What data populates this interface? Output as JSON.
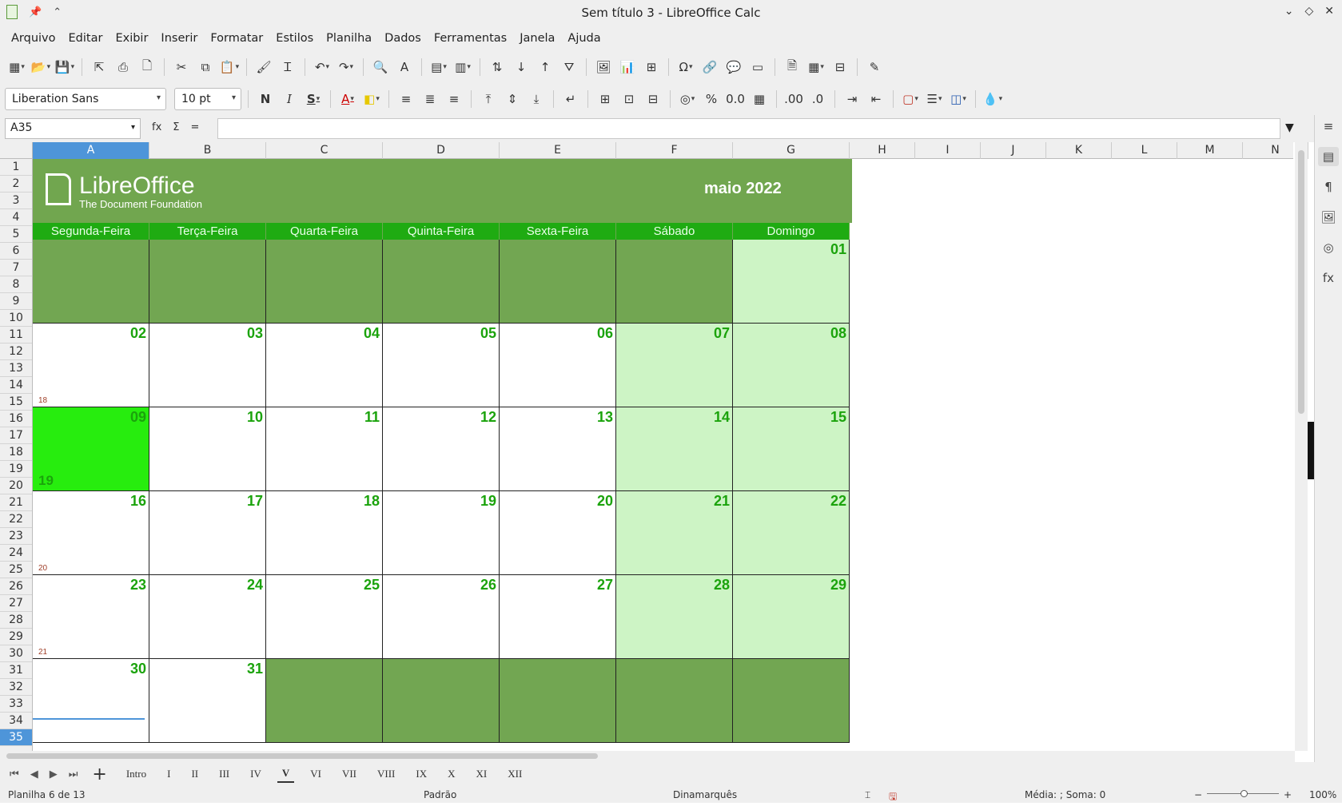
{
  "window": {
    "title": "Sem título 3 - LibreOffice Calc"
  },
  "menu": [
    "Arquivo",
    "Editar",
    "Exibir",
    "Inserir",
    "Formatar",
    "Estilos",
    "Planilha",
    "Dados",
    "Ferramentas",
    "Janela",
    "Ajuda"
  ],
  "format_bar": {
    "font_name": "Liberation Sans",
    "font_size": "10 pt",
    "bold": "N",
    "italic": "I",
    "underline": "S"
  },
  "formula_bar": {
    "cell_ref": "A35",
    "function_wizard": "fx",
    "sum": "Σ",
    "equals": "=",
    "content": ""
  },
  "columns": [
    "A",
    "B",
    "C",
    "D",
    "E",
    "F",
    "G",
    "H",
    "I",
    "J",
    "K",
    "L",
    "M",
    "N"
  ],
  "selected_column": "A",
  "rows": [
    "1",
    "2",
    "3",
    "4",
    "5",
    "6",
    "7",
    "8",
    "9",
    "10",
    "11",
    "12",
    "13",
    "14",
    "15",
    "16",
    "17",
    "18",
    "19",
    "20",
    "21",
    "22",
    "23",
    "24",
    "25",
    "26",
    "27",
    "28",
    "29",
    "30",
    "31",
    "32",
    "33",
    "34",
    "35"
  ],
  "selected_row": "35",
  "calendar": {
    "logo_brand": "LibreOffice",
    "logo_subtitle": "The Document Foundation",
    "month_title": "maio 2022",
    "weekdays": [
      "Segunda-Feira",
      "Terça-Feira",
      "Quarta-Feira",
      "Quinta-Feira",
      "Sexta-Feira",
      "Sábado",
      "Domingo"
    ],
    "weeks": [
      {
        "week_no": "",
        "days": [
          "",
          "",
          "",
          "",
          "",
          "",
          "01"
        ]
      },
      {
        "week_no": "18",
        "days": [
          "02",
          "03",
          "04",
          "05",
          "06",
          "07",
          "08"
        ]
      },
      {
        "week_no": "19",
        "days": [
          "09",
          "10",
          "11",
          "12",
          "13",
          "14",
          "15"
        ]
      },
      {
        "week_no": "20",
        "days": [
          "16",
          "17",
          "18",
          "19",
          "20",
          "21",
          "22"
        ]
      },
      {
        "week_no": "21",
        "days": [
          "23",
          "24",
          "25",
          "26",
          "27",
          "28",
          "29"
        ]
      },
      {
        "week_no": "",
        "days": [
          "30",
          "31",
          "",
          "",
          "",
          "",
          ""
        ]
      }
    ],
    "today": "09"
  },
  "sheet_tabs": [
    "Intro",
    "I",
    "II",
    "III",
    "IV",
    "V",
    "VI",
    "VII",
    "VIII",
    "IX",
    "X",
    "XI",
    "XII"
  ],
  "active_tab": "V",
  "status": {
    "sheet_info": "Planilha 6 de 13",
    "page_style": "Padrão",
    "language": "Dinamarquês",
    "summary": "Média: ; Soma: 0",
    "zoom": "100%"
  },
  "colors": {
    "banner_green": "#71a64f",
    "day_header_green": "#1fab12",
    "weekend_fill": "#cdf4c5",
    "today_fill": "#27ed0e",
    "day_number_green": "#1ba30c",
    "selection_blue": "#4e95d9"
  }
}
